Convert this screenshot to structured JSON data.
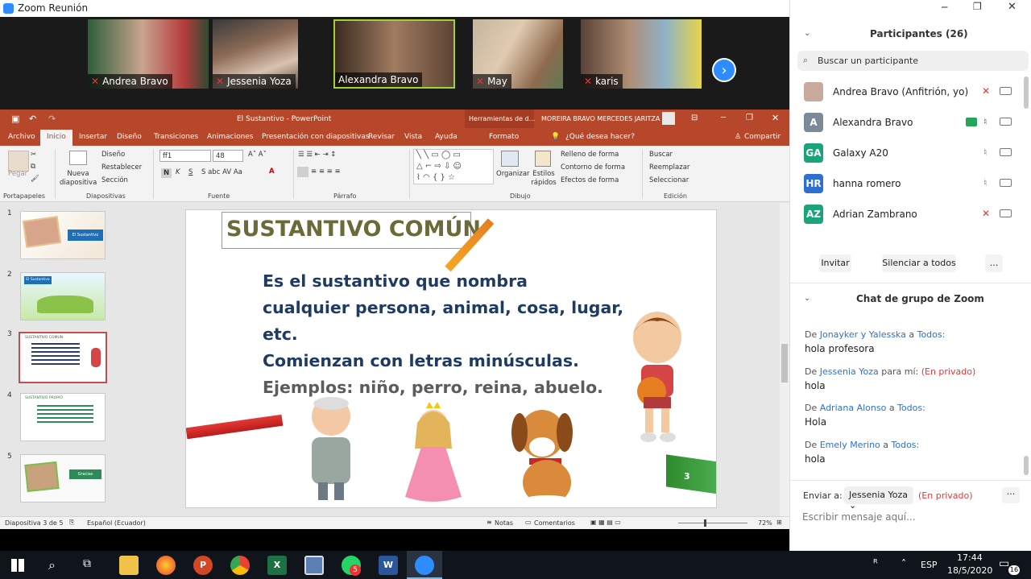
{
  "window": {
    "title": "Zoom Reunión"
  },
  "video_tiles": [
    {
      "name": "Andrea Bravo"
    },
    {
      "name": "Jessenia Yoza"
    },
    {
      "name": "Alexandra Bravo"
    },
    {
      "name": "May"
    },
    {
      "name": "karis"
    }
  ],
  "ppt": {
    "file_title": "El Sustantivo  -  PowerPoint",
    "tools_label": "Herramientas de d...",
    "user": "MOREIRA BRAVO MERCEDES JARITZA",
    "tabs": [
      "Archivo",
      "Inicio",
      "Insertar",
      "Diseño",
      "Transiciones",
      "Animaciones",
      "Presentación con diapositivas",
      "Revisar",
      "Vista",
      "Ayuda",
      "Formato"
    ],
    "tell_me": "¿Qué desea hacer?",
    "share": "Compartir",
    "ribbon": {
      "paste": "Pegar",
      "new_slide": "Nueva diapositiva",
      "layout": "Diseño",
      "reset": "Restablecer",
      "section": "Sección",
      "font_name": "ff1",
      "font_size": "48",
      "arrange": "Organizar",
      "quick_styles": "Estilos rápidos",
      "shape_fill": "Relleno de forma",
      "shape_outline": "Contorno de forma",
      "shape_effects": "Efectos de forma",
      "find": "Buscar",
      "replace": "Reemplazar",
      "select": "Seleccionar",
      "groups": [
        "Portapapeles",
        "Diapositivas",
        "Fuente",
        "Párrafo",
        "Dibujo",
        "Edición"
      ]
    },
    "thumb_numbers": [
      "1",
      "2",
      "3",
      "4",
      "5"
    ],
    "thumb_texts": [
      "El Sustantivo",
      "El Sustantivo",
      "SUSTANTIVO COMÚN",
      "SUSTANTIVO PROPIO",
      "Gracias"
    ],
    "slide": {
      "title": "SUSTANTIVO COMÚN",
      "line1": "Es el sustantivo que nombra",
      "line2": "cualquier persona, animal, cosa, lugar,",
      "line3": "etc.",
      "line4": "Comienzan con letras minúsculas.",
      "line5": "Ejemplos: niño, perro, reina, abuelo.",
      "number": "3"
    },
    "status": {
      "slide_of": "Diapositiva 3 de 5",
      "language": "Español (Ecuador)",
      "notes": "Notas",
      "comments": "Comentarios",
      "zoom": "72%"
    }
  },
  "participants": {
    "header": "Participantes (26)",
    "search_placeholder": "Buscar un participante",
    "list": [
      {
        "initials": "",
        "name": "Andrea Bravo (Anfitrión, yo)",
        "color": "#9a7b6a"
      },
      {
        "initials": "A",
        "name": "Alexandra Bravo",
        "color": "#7a8a99"
      },
      {
        "initials": "GA",
        "name": "Galaxy A20",
        "color": "#1ba37a"
      },
      {
        "initials": "HR",
        "name": "hanna romero",
        "color": "#2e6fd0"
      },
      {
        "initials": "AZ",
        "name": "Adrian Zambrano",
        "color": "#1ba37a"
      }
    ],
    "invite": "Invitar",
    "mute_all": "Silenciar a todos",
    "more": "..."
  },
  "chat": {
    "header": "Chat de grupo de Zoom",
    "messages": [
      {
        "prefix": "De ",
        "from": "Jonayker y Yalesska",
        "mid": " a ",
        "to": "Todos:",
        "priv": "",
        "text": "hola profesora"
      },
      {
        "prefix": "De ",
        "from": "Jessenia Yoza",
        "mid": " para mí: ",
        "to": "",
        "priv": "(En privado)",
        "text": "hola"
      },
      {
        "prefix": "De ",
        "from": "Adriana Alonso",
        "mid": " a ",
        "to": "Todos:",
        "priv": "",
        "text": "Hola"
      },
      {
        "prefix": "De ",
        "from": "Emely Merino",
        "mid": " a ",
        "to": "Todos:",
        "priv": "",
        "text": "hola"
      }
    ],
    "send_to_label": "Enviar a:",
    "send_to_value": "Jessenia Yoza",
    "private": "(En privado)",
    "input_placeholder": "Escribir mensaje aquí...",
    "more": "···"
  },
  "taskbar": {
    "ime": "ESP",
    "time": "17:44",
    "date": "18/5/2020",
    "whatsapp_badge": "5",
    "notif_count": "16"
  }
}
